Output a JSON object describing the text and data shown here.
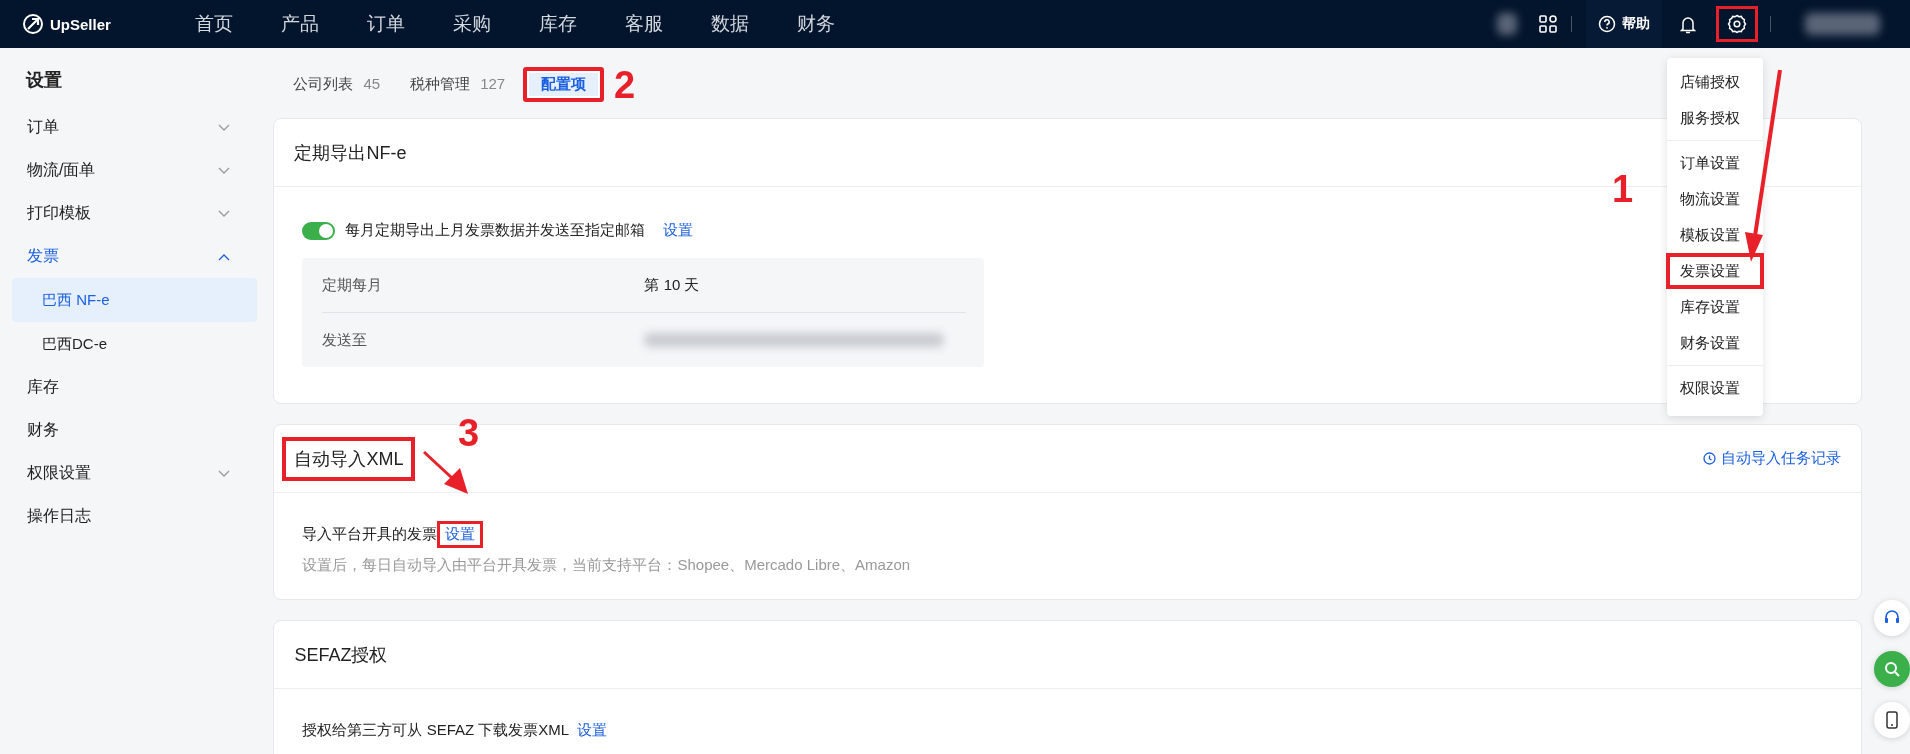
{
  "topbar": {
    "logo": "UpSeller",
    "nav": [
      {
        "label": "首页"
      },
      {
        "label": "产品"
      },
      {
        "label": "订单"
      },
      {
        "label": "采购"
      },
      {
        "label": "库存"
      },
      {
        "label": "客服"
      },
      {
        "label": "数据"
      },
      {
        "label": "财务"
      }
    ],
    "help": "帮助",
    "settings_highlighted": true
  },
  "sidebar": {
    "title": "设置",
    "items": [
      {
        "label": "订单",
        "kind": "group",
        "expanded": false,
        "selected": false
      },
      {
        "label": "物流/面单",
        "kind": "group",
        "expanded": false,
        "selected": false
      },
      {
        "label": "打印模板",
        "kind": "group",
        "expanded": false,
        "selected": false
      },
      {
        "label": "发票",
        "kind": "group",
        "expanded": true,
        "selected": true,
        "children": [
          {
            "label": "巴西 NF-e",
            "selected": true
          },
          {
            "label": "巴西DC-e",
            "selected": false
          }
        ]
      },
      {
        "label": "库存",
        "kind": "link",
        "selected": false
      },
      {
        "label": "财务",
        "kind": "link",
        "selected": false
      },
      {
        "label": "权限设置",
        "kind": "group",
        "expanded": false,
        "selected": false
      },
      {
        "label": "操作日志",
        "kind": "link",
        "selected": false
      }
    ]
  },
  "tabs": [
    {
      "label": "公司列表",
      "count": "45",
      "selected": false,
      "highlighted": false
    },
    {
      "label": "税种管理",
      "count": "127",
      "selected": false,
      "highlighted": false
    },
    {
      "label": "配置项",
      "selected": true,
      "highlighted": true
    }
  ],
  "cards": [
    {
      "title": "定期导出NF-e",
      "title_highlighted": false,
      "toggle": {
        "on": true,
        "label": "每月定期导出上月发票数据并发送至指定邮箱",
        "link": "设置"
      },
      "details": [
        {
          "label": "定期每月",
          "value": "第 10 天"
        },
        {
          "label": "发送至",
          "blurred": true
        }
      ]
    },
    {
      "title": "自动导入XML",
      "title_highlighted": true,
      "action": "自动导入任务记录",
      "line": "导入平台开具的发票",
      "link": "设置",
      "link_highlighted": true,
      "hint": "设置后，每日自动导入由平台开具发票，当前支持平台：Shopee、Mercado Libre、Amazon"
    },
    {
      "title": "SEFAZ授权",
      "title_highlighted": false,
      "line": "授权给第三方可从 SEFAZ 下载发票XML",
      "link": "设置",
      "link_highlighted": false
    }
  ],
  "dropdown": {
    "groups": [
      [
        {
          "label": "店铺授权",
          "highlighted": false
        },
        {
          "label": "服务授权",
          "highlighted": false
        }
      ],
      [
        {
          "label": "订单设置",
          "highlighted": false
        },
        {
          "label": "物流设置",
          "highlighted": false
        },
        {
          "label": "模板设置",
          "highlighted": false
        },
        {
          "label": "发票设置",
          "highlighted": true
        },
        {
          "label": "库存设置",
          "highlighted": false
        },
        {
          "label": "财务设置",
          "highlighted": false
        }
      ],
      [
        {
          "label": "权限设置",
          "highlighted": false
        }
      ]
    ]
  },
  "callouts": [
    {
      "number": "1"
    },
    {
      "number": "2"
    },
    {
      "number": "3"
    }
  ]
}
